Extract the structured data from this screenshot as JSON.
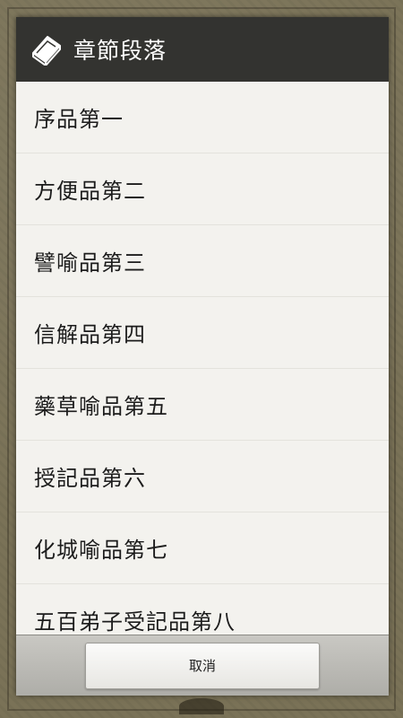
{
  "dialog": {
    "title": "章節段落",
    "icon": "book-icon",
    "items": [
      {
        "label": "序品第一"
      },
      {
        "label": "方便品第二"
      },
      {
        "label": "譬喻品第三"
      },
      {
        "label": "信解品第四"
      },
      {
        "label": "藥草喻品第五"
      },
      {
        "label": "授記品第六"
      },
      {
        "label": "化城喻品第七"
      },
      {
        "label": "五百弟子受記品第八"
      }
    ],
    "cancel_label": "取消"
  },
  "colors": {
    "header": "#333330",
    "list_bg": "#f3f2ee",
    "background": "#7a7257"
  }
}
